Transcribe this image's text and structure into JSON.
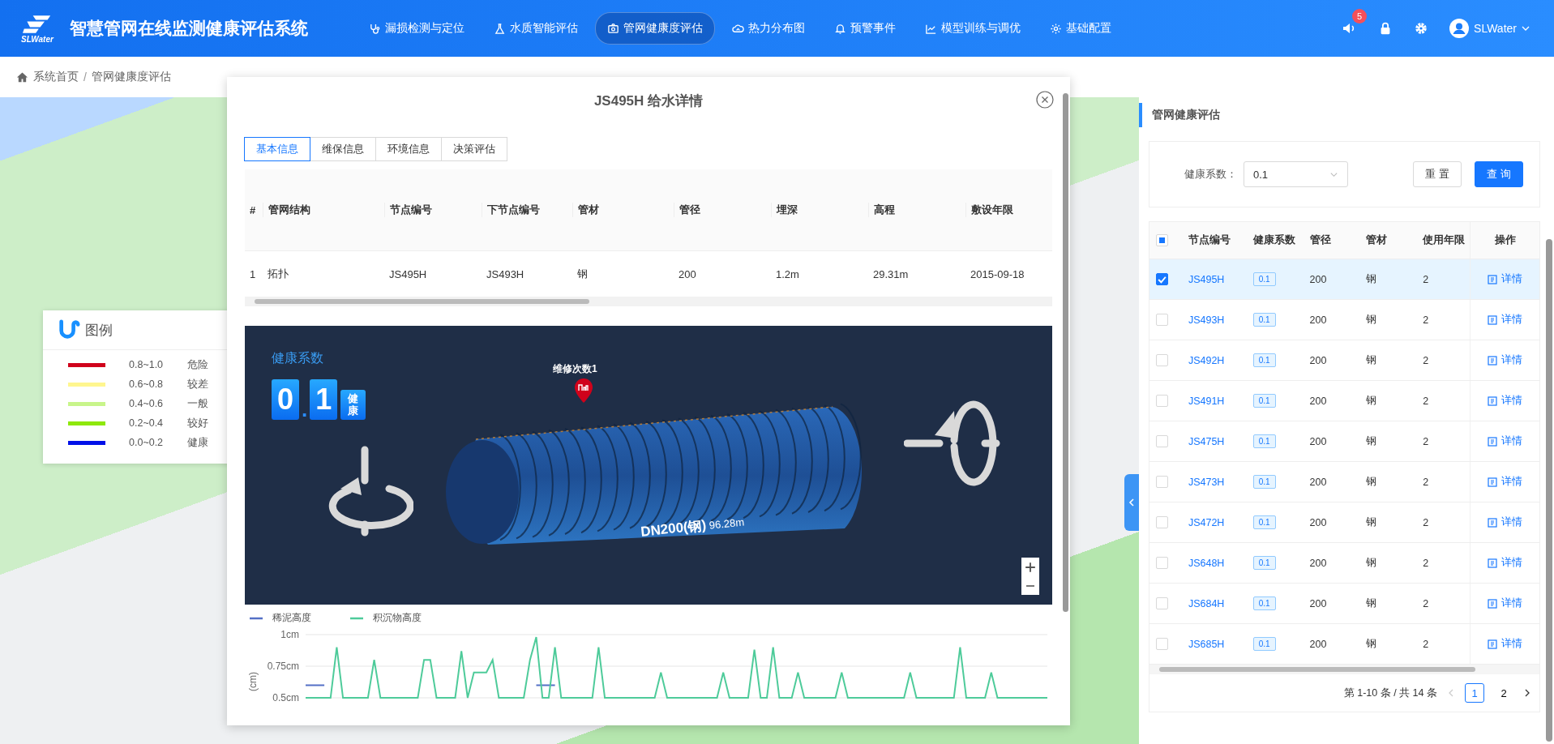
{
  "header": {
    "logo_text": "SLWater",
    "title": "智慧管网在线监测健康评估系统",
    "nav": [
      {
        "label": "漏损检测与定位",
        "kind": "stethoscope",
        "selected": false
      },
      {
        "label": "水质智能评估",
        "kind": "flask",
        "selected": false
      },
      {
        "label": "管网健康度评估",
        "kind": "camera",
        "selected": true
      },
      {
        "label": "热力分布图",
        "kind": "cloud",
        "selected": false
      },
      {
        "label": "预警事件",
        "kind": "bell",
        "selected": false
      },
      {
        "label": "模型训练与调优",
        "kind": "chart",
        "selected": false
      },
      {
        "label": "基础配置",
        "kind": "gear",
        "selected": false
      }
    ],
    "notification_count": "5",
    "user": "SLWater"
  },
  "breadcrumb": {
    "separator": "/",
    "items": [
      "系统首页",
      "管网健康度评估"
    ]
  },
  "legend": {
    "title": "图例",
    "items": [
      {
        "range": "0.8~1.0",
        "label": "危险",
        "color": "#d0021b"
      },
      {
        "range": "0.6~0.8",
        "label": "较差",
        "color": "#fff68f"
      },
      {
        "range": "0.4~0.6",
        "label": "一般",
        "color": "#c8f58a"
      },
      {
        "range": "0.2~0.4",
        "label": "较好",
        "color": "#8ee80c"
      },
      {
        "range": "0.0~0.2",
        "label": "健康",
        "color": "#0010e8"
      }
    ]
  },
  "dialog": {
    "title": "JS495H 给水详情",
    "tabs": [
      {
        "label": "基本信息",
        "selected": true
      },
      {
        "label": "维保信息",
        "selected": false
      },
      {
        "label": "环境信息",
        "selected": false
      },
      {
        "label": "决策评估",
        "selected": false
      }
    ],
    "table": {
      "columns": [
        "#",
        "管网结构",
        "节点编号",
        "下节点编号",
        "管材",
        "管径",
        "埋深",
        "高程",
        "敷设年限"
      ],
      "rows": [
        [
          "1",
          "拓扑",
          "JS495H",
          "JS493H",
          "钢",
          "200",
          "1.2m",
          "29.31m",
          "2015-09-18"
        ]
      ]
    },
    "viewer": {
      "health_label": "健康系数",
      "health_value": "0.1",
      "health_status": "健康",
      "marker_label": "维修次数1",
      "pipe_label": "DN200(钢)",
      "pipe_length": "96.28m"
    },
    "chart_data": {
      "type": "line",
      "ylabel": "(cm)",
      "ylim": [
        0.5,
        1
      ],
      "grid": true,
      "yticks": [
        {
          "value": 1,
          "label": "1cm"
        },
        {
          "value": 0.75,
          "label": "0.75cm"
        },
        {
          "value": 0.5,
          "label": "0.5cm"
        }
      ],
      "series": [
        {
          "name": "稀泥高度",
          "color": "#5470c6",
          "values": [
            0.6,
            0.6,
            0.6,
            0.6,
            null,
            null,
            null,
            null,
            null,
            null,
            null,
            null,
            null,
            null,
            null,
            null,
            null,
            null,
            null,
            null,
            null,
            null,
            null,
            null,
            null,
            null,
            null,
            null,
            null,
            null,
            null,
            null,
            null,
            null,
            null,
            null,
            null,
            0.6,
            0.6,
            0.6,
            0.6,
            null,
            null,
            null,
            null,
            null,
            null,
            null,
            null,
            null,
            null,
            null,
            null,
            null,
            null,
            null,
            null,
            null,
            null,
            null,
            null,
            null,
            null,
            null,
            null,
            null,
            null,
            null,
            null,
            null,
            null,
            null,
            null,
            null,
            null,
            null,
            null,
            null,
            null,
            null,
            null,
            null,
            null,
            null,
            null,
            null,
            null,
            null,
            null,
            null,
            null,
            null,
            null,
            null,
            null,
            null,
            null,
            null,
            null,
            null,
            null,
            null,
            null,
            null,
            null,
            null,
            null,
            null,
            null,
            null,
            null,
            null,
            null,
            null,
            null,
            null,
            null,
            null,
            null,
            null
          ]
        },
        {
          "name": "积沉物高度",
          "color": "#4ecb9a",
          "values": [
            0.5,
            0.5,
            0.5,
            0.5,
            0.5,
            0.9,
            0.5,
            0.5,
            0.5,
            0.5,
            0.5,
            0.8,
            0.5,
            0.5,
            0.5,
            0.5,
            0.5,
            0.5,
            0.5,
            0.8,
            0.8,
            0.5,
            0.5,
            0.5,
            0.5,
            0.87,
            0.5,
            0.7,
            0.7,
            0.7,
            0.8,
            0.5,
            0.5,
            0.5,
            0.5,
            0.5,
            0.8,
            0.98,
            0.5,
            0.5,
            0.9,
            0.5,
            0.5,
            0.5,
            0.5,
            0.5,
            0.5,
            0.9,
            0.5,
            0.5,
            0.5,
            0.5,
            0.5,
            0.5,
            0.5,
            0.5,
            0.5,
            0.7,
            0.5,
            0.5,
            0.5,
            0.5,
            0.5,
            0.5,
            0.5,
            0.5,
            0.5,
            0.7,
            0.5,
            0.5,
            0.5,
            0.5,
            0.88,
            0.5,
            0.5,
            0.9,
            0.5,
            0.5,
            0.5,
            0.7,
            0.5,
            0.5,
            0.5,
            0.5,
            0.5,
            0.5,
            0.7,
            0.5,
            0.5,
            0.5,
            0.5,
            0.5,
            0.5,
            0.5,
            0.5,
            0.5,
            0.5,
            0.7,
            0.5,
            0.5,
            0.5,
            0.5,
            0.5,
            0.5,
            0.5,
            0.9,
            0.5,
            0.5,
            0.5,
            0.5,
            0.7,
            0.5,
            0.5,
            0.5,
            0.5,
            0.5,
            0.5,
            0.5,
            0.5,
            0.5
          ]
        }
      ]
    }
  },
  "panel": {
    "title": "管网健康评估",
    "filter": {
      "label": "健康系数：",
      "value": "0.1"
    },
    "reset_button": "重 置",
    "query_button": "查 询",
    "table": {
      "select_all_partial": true,
      "columns": [
        "节点编号",
        "健康系数",
        "管径",
        "管材",
        "使用年限",
        "操作"
      ],
      "rows": [
        {
          "node": "JS495H",
          "health": "0.1",
          "diameter": "200",
          "material": "钢",
          "years": "2",
          "action": "详情",
          "checked": true,
          "selected": true
        },
        {
          "node": "JS493H",
          "health": "0.1",
          "diameter": "200",
          "material": "钢",
          "years": "2",
          "action": "详情",
          "checked": false,
          "selected": false
        },
        {
          "node": "JS492H",
          "health": "0.1",
          "diameter": "200",
          "material": "钢",
          "years": "2",
          "action": "详情",
          "checked": false,
          "selected": false
        },
        {
          "node": "JS491H",
          "health": "0.1",
          "diameter": "200",
          "material": "钢",
          "years": "2",
          "action": "详情",
          "checked": false,
          "selected": false
        },
        {
          "node": "JS475H",
          "health": "0.1",
          "diameter": "200",
          "material": "钢",
          "years": "2",
          "action": "详情",
          "checked": false,
          "selected": false
        },
        {
          "node": "JS473H",
          "health": "0.1",
          "diameter": "200",
          "material": "钢",
          "years": "2",
          "action": "详情",
          "checked": false,
          "selected": false
        },
        {
          "node": "JS472H",
          "health": "0.1",
          "diameter": "200",
          "material": "钢",
          "years": "2",
          "action": "详情",
          "checked": false,
          "selected": false
        },
        {
          "node": "JS648H",
          "health": "0.1",
          "diameter": "200",
          "material": "钢",
          "years": "2",
          "action": "详情",
          "checked": false,
          "selected": false
        },
        {
          "node": "JS684H",
          "health": "0.1",
          "diameter": "200",
          "material": "钢",
          "years": "2",
          "action": "详情",
          "checked": false,
          "selected": false
        },
        {
          "node": "JS685H",
          "health": "0.1",
          "diameter": "200",
          "material": "钢",
          "years": "2",
          "action": "详情",
          "checked": false,
          "selected": false
        }
      ]
    },
    "pagination": {
      "summary": "第 1-10 条 / 共 14 条",
      "pages": [
        {
          "label": "1",
          "selected": true
        },
        {
          "label": "2",
          "selected": false
        }
      ]
    }
  }
}
